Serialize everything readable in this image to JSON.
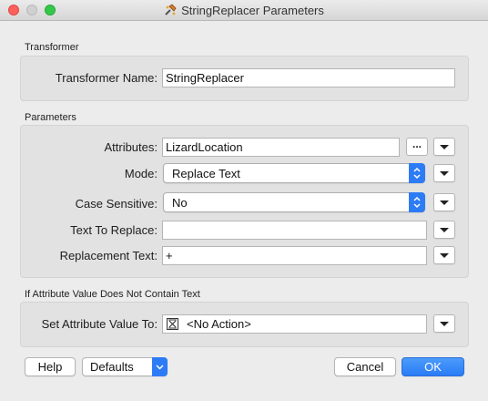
{
  "window": {
    "title": "StringReplacer Parameters"
  },
  "transformer_section": {
    "heading": "Transformer",
    "name_label": "Transformer Name:",
    "name_value": "StringReplacer"
  },
  "parameters_section": {
    "heading": "Parameters",
    "attributes_label": "Attributes:",
    "attributes_value": "LizardLocation",
    "attributes_browse_label": "...",
    "mode_label": "Mode:",
    "mode_value": "Replace Text",
    "case_label": "Case Sensitive:",
    "case_value": "No",
    "text_to_replace_label": "Text To Replace:",
    "text_to_replace_value": "",
    "replacement_label": "Replacement Text:",
    "replacement_value": "+"
  },
  "no_text_section": {
    "heading": "If Attribute Value Does Not Contain Text",
    "set_value_label": "Set Attribute Value To:",
    "set_value_value": "<No Action>"
  },
  "footer": {
    "help_label": "Help",
    "defaults_label": "Defaults",
    "cancel_label": "Cancel",
    "ok_label": "OK"
  },
  "colors": {
    "accent": "#2d7cf6",
    "close": "#fc605c",
    "maximize": "#34c84a"
  }
}
